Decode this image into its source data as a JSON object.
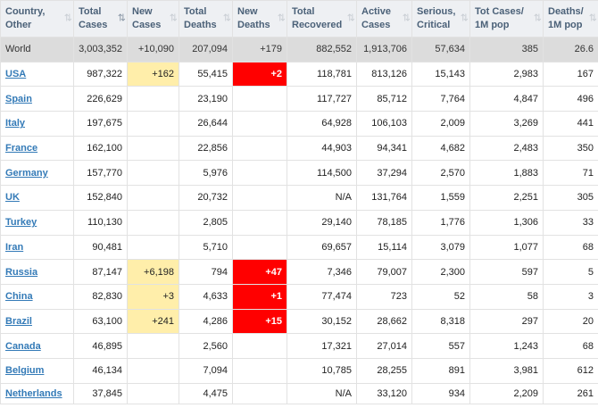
{
  "headers": [
    {
      "label": "Country,\nOther",
      "sorted": false
    },
    {
      "label": "Total\nCases",
      "sorted": true
    },
    {
      "label": "New\nCases",
      "sorted": false
    },
    {
      "label": "Total\nDeaths",
      "sorted": false
    },
    {
      "label": "New\nDeaths",
      "sorted": false
    },
    {
      "label": "Total\nRecovered",
      "sorted": false
    },
    {
      "label": "Active\nCases",
      "sorted": false
    },
    {
      "label": "Serious,\nCritical",
      "sorted": false
    },
    {
      "label": "Tot Cases/\n1M pop",
      "sorted": false
    },
    {
      "label": "Deaths/\n1M pop",
      "sorted": false
    }
  ],
  "sort_icons": {
    "inactive": "⇅",
    "active": "⇅"
  },
  "world": {
    "country": "World",
    "total_cases": "3,003,352",
    "new_cases": "+10,090",
    "total_deaths": "207,094",
    "new_deaths": "+179",
    "total_recovered": "882,552",
    "active_cases": "1,913,706",
    "serious_critical": "57,634",
    "tot_cases_1m": "385",
    "deaths_1m": "26.6"
  },
  "rows": [
    {
      "country": "USA",
      "total_cases": "987,322",
      "new_cases": "+162",
      "total_deaths": "55,415",
      "new_deaths": "+2",
      "total_recovered": "118,781",
      "active_cases": "813,126",
      "serious_critical": "15,143",
      "tot_cases_1m": "2,983",
      "deaths_1m": "167"
    },
    {
      "country": "Spain",
      "total_cases": "226,629",
      "new_cases": "",
      "total_deaths": "23,190",
      "new_deaths": "",
      "total_recovered": "117,727",
      "active_cases": "85,712",
      "serious_critical": "7,764",
      "tot_cases_1m": "4,847",
      "deaths_1m": "496"
    },
    {
      "country": "Italy",
      "total_cases": "197,675",
      "new_cases": "",
      "total_deaths": "26,644",
      "new_deaths": "",
      "total_recovered": "64,928",
      "active_cases": "106,103",
      "serious_critical": "2,009",
      "tot_cases_1m": "3,269",
      "deaths_1m": "441"
    },
    {
      "country": "France",
      "total_cases": "162,100",
      "new_cases": "",
      "total_deaths": "22,856",
      "new_deaths": "",
      "total_recovered": "44,903",
      "active_cases": "94,341",
      "serious_critical": "4,682",
      "tot_cases_1m": "2,483",
      "deaths_1m": "350"
    },
    {
      "country": "Germany",
      "total_cases": "157,770",
      "new_cases": "",
      "total_deaths": "5,976",
      "new_deaths": "",
      "total_recovered": "114,500",
      "active_cases": "37,294",
      "serious_critical": "2,570",
      "tot_cases_1m": "1,883",
      "deaths_1m": "71"
    },
    {
      "country": "UK",
      "total_cases": "152,840",
      "new_cases": "",
      "total_deaths": "20,732",
      "new_deaths": "",
      "total_recovered": "N/A",
      "active_cases": "131,764",
      "serious_critical": "1,559",
      "tot_cases_1m": "2,251",
      "deaths_1m": "305"
    },
    {
      "country": "Turkey",
      "total_cases": "110,130",
      "new_cases": "",
      "total_deaths": "2,805",
      "new_deaths": "",
      "total_recovered": "29,140",
      "active_cases": "78,185",
      "serious_critical": "1,776",
      "tot_cases_1m": "1,306",
      "deaths_1m": "33"
    },
    {
      "country": "Iran",
      "total_cases": "90,481",
      "new_cases": "",
      "total_deaths": "5,710",
      "new_deaths": "",
      "total_recovered": "69,657",
      "active_cases": "15,114",
      "serious_critical": "3,079",
      "tot_cases_1m": "1,077",
      "deaths_1m": "68"
    },
    {
      "country": "Russia",
      "total_cases": "87,147",
      "new_cases": "+6,198",
      "total_deaths": "794",
      "new_deaths": "+47",
      "total_recovered": "7,346",
      "active_cases": "79,007",
      "serious_critical": "2,300",
      "tot_cases_1m": "597",
      "deaths_1m": "5"
    },
    {
      "country": "China",
      "total_cases": "82,830",
      "new_cases": "+3",
      "total_deaths": "4,633",
      "new_deaths": "+1",
      "total_recovered": "77,474",
      "active_cases": "723",
      "serious_critical": "52",
      "tot_cases_1m": "58",
      "deaths_1m": "3"
    },
    {
      "country": "Brazil",
      "total_cases": "63,100",
      "new_cases": "+241",
      "total_deaths": "4,286",
      "new_deaths": "+15",
      "total_recovered": "30,152",
      "active_cases": "28,662",
      "serious_critical": "8,318",
      "tot_cases_1m": "297",
      "deaths_1m": "20"
    },
    {
      "country": "Canada",
      "total_cases": "46,895",
      "new_cases": "",
      "total_deaths": "2,560",
      "new_deaths": "",
      "total_recovered": "17,321",
      "active_cases": "27,014",
      "serious_critical": "557",
      "tot_cases_1m": "1,243",
      "deaths_1m": "68"
    },
    {
      "country": "Belgium",
      "total_cases": "46,134",
      "new_cases": "",
      "total_deaths": "7,094",
      "new_deaths": "",
      "total_recovered": "10,785",
      "active_cases": "28,255",
      "serious_critical": "891",
      "tot_cases_1m": "3,981",
      "deaths_1m": "612"
    },
    {
      "country": "Netherlands",
      "total_cases": "37,845",
      "new_cases": "",
      "total_deaths": "4,475",
      "new_deaths": "",
      "total_recovered": "N/A",
      "active_cases": "33,120",
      "serious_critical": "934",
      "tot_cases_1m": "2,209",
      "deaths_1m": "261"
    }
  ],
  "colors": {
    "new_cases_highlight": "#ffeeaa",
    "new_deaths_highlight": "#ff0000",
    "link": "#337ab7",
    "header_bg": "#eef0f3",
    "world_bg": "#dcdcdc"
  }
}
